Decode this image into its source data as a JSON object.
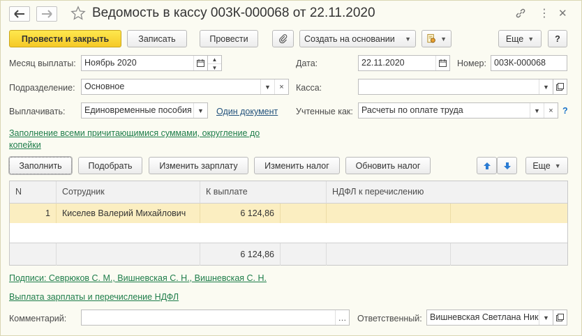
{
  "window": {
    "title": "Ведомость в кассу 003К-000068 от 22.11.2020"
  },
  "toolbar": {
    "post_close": "Провести и закрыть",
    "save": "Записать",
    "post": "Провести",
    "create_based": "Создать на основании",
    "more": "Еще",
    "help": "?"
  },
  "form": {
    "month_label": "Месяц выплаты:",
    "month_value": "Ноябрь 2020",
    "date_label": "Дата:",
    "date_value": "22.11.2020",
    "number_label": "Номер:",
    "number_value": "003К-000068",
    "division_label": "Подразделение:",
    "division_value": "Основное",
    "cash_label": "Касса:",
    "cash_value": "",
    "pay_label": "Выплачивать:",
    "pay_value": "Единовременные пособия",
    "one_doc_link": "Один документ",
    "accounted_label": "Учтенные как:",
    "accounted_value": "Расчеты по оплате труда",
    "help_mark": "?",
    "fill_link": "Заполнение всеми причитающимися суммами, округление до копейки"
  },
  "table_toolbar": {
    "fill": "Заполнить",
    "select": "Подобрать",
    "change_salary": "Изменить зарплату",
    "change_tax": "Изменить налог",
    "update_tax": "Обновить налог",
    "more": "Еще"
  },
  "table": {
    "columns": [
      "N",
      "Сотрудник",
      "К выплате",
      "НДФЛ к перечислению"
    ],
    "rows": [
      {
        "n": "1",
        "employee": "Киселев Валерий Михайлович",
        "amount": "6 124,86",
        "tax": ""
      }
    ],
    "total_amount": "6 124,86"
  },
  "footer": {
    "signatures_link": "Подписи: Севрюков С. М., Вишневская С. Н., Вишневская С. Н.",
    "payout_link": "Выплата зарплаты и перечисление НДФЛ",
    "comment_label": "Комментарий:",
    "comment_value": "",
    "responsible_label": "Ответственный:",
    "responsible_value": "Вишневская Светлана Николаевна"
  },
  "colors": {
    "primary_button": "#f5c927",
    "link_green": "#1e7d4a",
    "selected_row": "#fbeec1",
    "background": "#fbfbf2"
  }
}
